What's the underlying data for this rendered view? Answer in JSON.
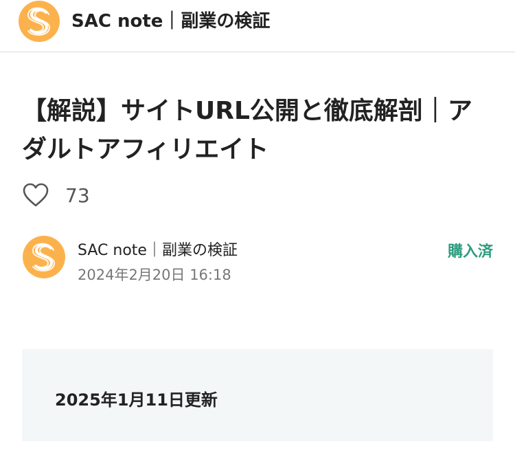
{
  "header": {
    "site_name": "SAC note｜副業の検証",
    "avatar_icon": "sac-logo-icon"
  },
  "article": {
    "title": "【解説】サイトURL公開と徹底解剖｜アダルトアフィリエイト",
    "like_count": "73",
    "like_icon": "heart-icon"
  },
  "author": {
    "name": "SAC note｜副業の検証",
    "date": "2024年2月20日 16:18",
    "status": "購入済"
  },
  "notice": {
    "text": "2025年1月11日更新"
  },
  "colors": {
    "brand_orange": "#fcb24c",
    "status_green": "#2d9c7f",
    "notice_bg": "#f3f7f8"
  }
}
